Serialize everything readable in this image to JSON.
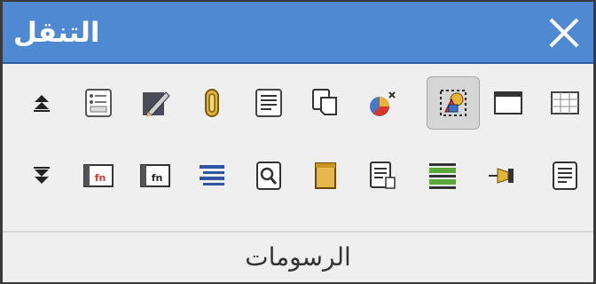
{
  "window": {
    "title": "التنقل",
    "close_icon": "close-icon",
    "title_bar_color": "#4f89d2"
  },
  "toolbar": {
    "row1": [
      {
        "icon": "scroll-up-icon",
        "state": "normal"
      },
      {
        "icon": "form-icon",
        "state": "normal"
      },
      {
        "icon": "edit-pen-icon",
        "state": "normal"
      },
      {
        "icon": "paperclip-icon",
        "state": "normal"
      },
      {
        "icon": "text-document-icon",
        "state": "normal"
      },
      {
        "icon": "copy-pages-icon",
        "state": "normal"
      },
      {
        "icon": "ole-object-icon",
        "state": "normal"
      },
      {
        "icon": "drawings-icon",
        "state": "active"
      },
      {
        "icon": "frame-icon",
        "state": "normal"
      },
      {
        "icon": "table-icon",
        "state": "normal"
      }
    ],
    "row2": [
      {
        "icon": "scroll-down-icon",
        "state": "normal"
      },
      {
        "icon": "function-red-icon",
        "state": "normal"
      },
      {
        "icon": "function-icon",
        "state": "normal"
      },
      {
        "icon": "list-blue-icon",
        "state": "normal"
      },
      {
        "icon": "search-page-icon",
        "state": "normal"
      },
      {
        "icon": "scroll-object-icon",
        "state": "normal"
      },
      {
        "icon": "insert-field-icon",
        "state": "normal"
      },
      {
        "icon": "table-green-icon",
        "state": "normal"
      },
      {
        "icon": "bookmark-pin-icon",
        "state": "normal"
      },
      {
        "icon": "text-lines-icon",
        "state": "normal"
      }
    ]
  },
  "footer": {
    "label": "الرسومات"
  }
}
